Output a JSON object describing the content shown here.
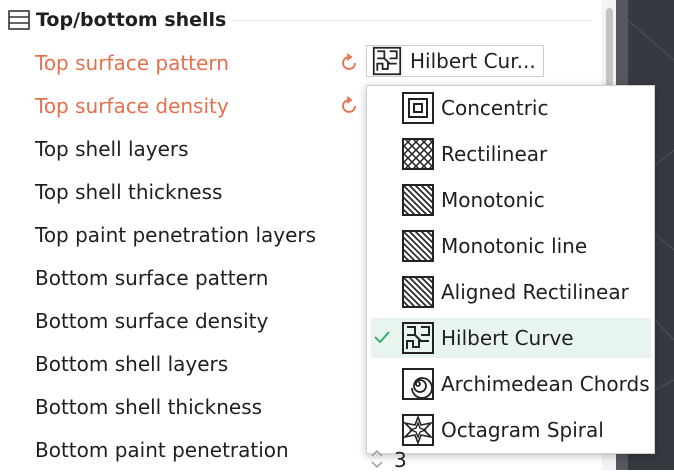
{
  "section": {
    "title": "Top/bottom shells"
  },
  "settings": [
    {
      "label": "Top surface pattern",
      "modified": true
    },
    {
      "label": "Top surface density",
      "modified": true
    },
    {
      "label": "Top shell layers",
      "modified": false
    },
    {
      "label": "Top shell thickness",
      "modified": false
    },
    {
      "label": "Top paint penetration layers",
      "modified": false
    },
    {
      "label": "Bottom surface pattern",
      "modified": false
    },
    {
      "label": "Bottom surface density",
      "modified": false
    },
    {
      "label": "Bottom shell layers",
      "modified": false
    },
    {
      "label": "Bottom shell thickness",
      "modified": false
    },
    {
      "label": "Bottom paint penetration",
      "modified": false
    }
  ],
  "combo": {
    "value": "Hilbert Cur...",
    "icon": "hilbert-curve-icon"
  },
  "dropdown": {
    "selected_index": 5,
    "options": [
      {
        "label": "Concentric",
        "icon": "concentric-icon"
      },
      {
        "label": "Rectilinear",
        "icon": "rectilinear-icon"
      },
      {
        "label": "Monotonic",
        "icon": "monotonic-icon"
      },
      {
        "label": "Monotonic line",
        "icon": "monotonic-line-icon"
      },
      {
        "label": "Aligned Rectilinear",
        "icon": "aligned-rectilinear-icon"
      },
      {
        "label": "Hilbert Curve",
        "icon": "hilbert-curve-icon"
      },
      {
        "label": "Archimedean Chords",
        "icon": "archimedean-chords-icon"
      },
      {
        "label": "Octagram Spiral",
        "icon": "octagram-spiral-icon"
      }
    ]
  },
  "stepper": {
    "value": "3"
  },
  "colors": {
    "modified_label": "#e5704d",
    "selected_row": "#e8f4ee",
    "check": "#2aa86a"
  }
}
